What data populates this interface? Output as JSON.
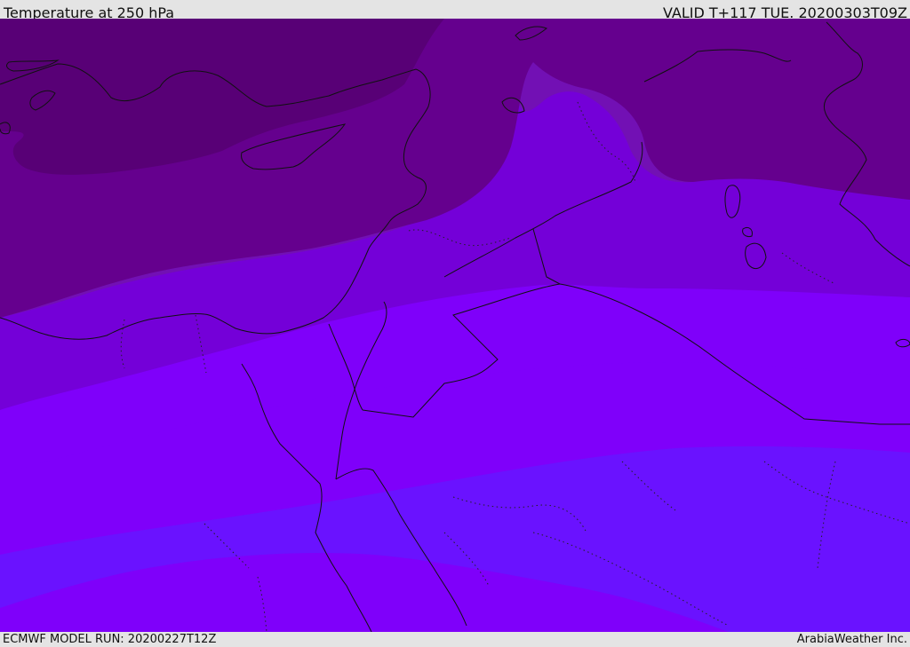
{
  "header": {
    "title": "Temperature at 250 hPa",
    "valid": "VALID T+117 TUE. 20200303T09Z"
  },
  "footer": {
    "model_run": "ECMWF MODEL RUN: 20200227T12Z",
    "credit": "ArabiaWeather Inc."
  },
  "map": {
    "bands": [
      {
        "id": "band-1",
        "color": "#580076"
      },
      {
        "id": "band-2",
        "color": "#65008e"
      },
      {
        "id": "band-3",
        "color": "#7210b4"
      },
      {
        "id": "band-4",
        "color": "#7400d8"
      },
      {
        "id": "band-5",
        "color": "#7f00fa"
      },
      {
        "id": "band-6",
        "color": "#6a12ff"
      }
    ],
    "coastline_color": "#111111",
    "border_color": "#111111"
  }
}
